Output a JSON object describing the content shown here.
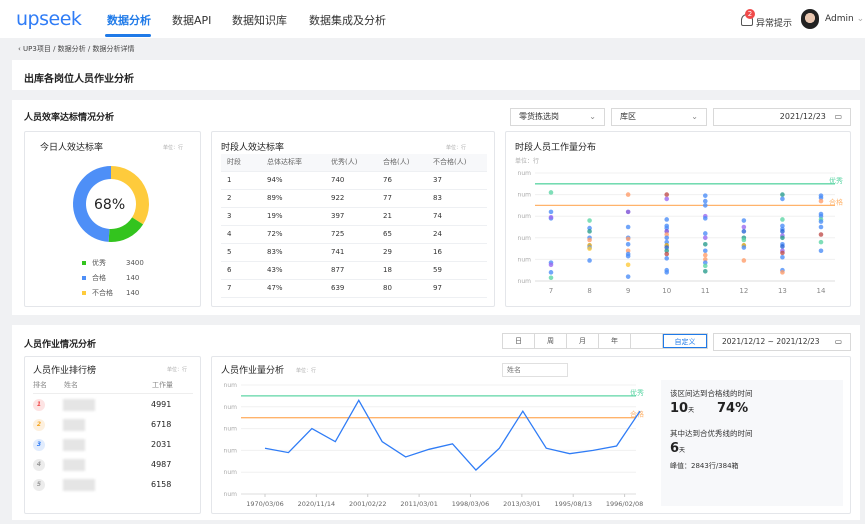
{
  "header": {
    "logo": "upseek",
    "nav": [
      "数据分析",
      "数据API",
      "数据知识库",
      "数据集成及分析"
    ],
    "alert_count": "2",
    "alert_label": "异常提示",
    "user": "Admin"
  },
  "breadcrumb": [
    "UP3项目",
    "数据分析",
    "数据分析详情"
  ],
  "page_title": "出库各岗位人员作业分析",
  "section1": {
    "title": "人员效率达标情况分析",
    "filters": {
      "post": "零货拣选岗",
      "area": "库区",
      "date": "2021/12/23"
    },
    "donut": {
      "title": "今日人效达标率",
      "unit": "单位：行",
      "center": "68%",
      "colors": {
        "优秀": "#33c41e",
        "合格": "#4e8ff7",
        "不合格": "#fecb3c"
      },
      "legend": [
        {
          "label": "优秀",
          "value": "3400",
          "color": "#33c41e"
        },
        {
          "label": "合格",
          "value": "140",
          "color": "#4e8ff7"
        },
        {
          "label": "不合格",
          "value": "140",
          "color": "#fecb3c"
        }
      ],
      "share": {
        "不合格": 0.34,
        "优秀": 0.17,
        "合格": 0.49
      }
    },
    "table": {
      "title": "时段人效达标率",
      "unit": "单位：行",
      "columns": [
        "时段",
        "总体达标率",
        "优秀(人)",
        "合格(人)",
        "不合格(人)"
      ],
      "rows": [
        [
          "1",
          "94%",
          "740",
          "76",
          "37"
        ],
        [
          "2",
          "89%",
          "922",
          "77",
          "83"
        ],
        [
          "3",
          "19%",
          "397",
          "21",
          "74"
        ],
        [
          "4",
          "72%",
          "725",
          "65",
          "24"
        ],
        [
          "5",
          "83%",
          "741",
          "29",
          "16"
        ],
        [
          "6",
          "43%",
          "877",
          "18",
          "59"
        ],
        [
          "7",
          "47%",
          "639",
          "80",
          "97"
        ]
      ]
    },
    "scatter": {
      "title": "时段人员工作量分布",
      "unit": "单位：行",
      "excellent_label": "优秀",
      "pass_label": "合格"
    }
  },
  "section2": {
    "title": "人员作业情况分析",
    "periods": [
      "日",
      "周",
      "月",
      "年",
      "",
      "自定义"
    ],
    "active_period": "自定义",
    "date_range": {
      "start": "2021/12/12",
      "sep": "~",
      "end": "2021/12/23"
    },
    "ranking": {
      "title": "人员作业排行榜",
      "unit": "单位：行",
      "columns": [
        "排名",
        "姓名",
        "工作量"
      ],
      "rows": [
        {
          "rank": "1",
          "value": "4991",
          "color": "#f04a4a",
          "bg": "#fde3e3"
        },
        {
          "rank": "2",
          "value": "6718",
          "color": "#f5a623",
          "bg": "#fdf0de"
        },
        {
          "rank": "3",
          "value": "2031",
          "color": "#2f7cf6",
          "bg": "#e1ecfd"
        },
        {
          "rank": "4",
          "value": "4987",
          "color": "#999",
          "bg": "#ececec"
        },
        {
          "rank": "5",
          "value": "6158",
          "color": "#999",
          "bg": "#ececec"
        }
      ]
    },
    "workload": {
      "title": "人员作业量分析",
      "unit": "单位：行",
      "name_placeholder": "姓名",
      "stats": {
        "pass_title": "该区间达到合格线的时间",
        "pass_days": "10",
        "day_unit": "天",
        "pass_pct": "74%",
        "exc_title": "其中达到合优秀线的时间",
        "exc_days": "6",
        "peak": "峰值：2843行/384箱"
      }
    }
  },
  "chart_data": [
    {
      "type": "scatter",
      "title": "时段人员工作量分布",
      "ylabel": "单位：行",
      "categories": [
        "7",
        "8",
        "9",
        "10",
        "11",
        "12",
        "13",
        "14"
      ],
      "y_tick_labels": [
        "num",
        "num",
        "num",
        "num",
        "num",
        "num"
      ],
      "ylim": [
        0,
        5
      ],
      "grid": true,
      "reference_lines": [
        {
          "name": "优秀",
          "value": 4.5,
          "color": "#5fd6a6"
        },
        {
          "name": "合格",
          "value": 3.5,
          "color": "#ffb36b"
        }
      ],
      "points": [
        [
          7,
          4.1,
          "#5fd6a6"
        ],
        [
          7,
          3.2,
          "#4e8ff7"
        ],
        [
          7,
          2.9,
          "#4e8ff7"
        ],
        [
          7,
          2.95,
          "#9b6cf0"
        ],
        [
          7,
          0.85,
          "#4e8ff7"
        ],
        [
          7,
          0.75,
          "#9b6cf0"
        ],
        [
          7,
          0.4,
          "#4e8ff7"
        ],
        [
          7,
          0.15,
          "#5fd6a6"
        ],
        [
          8,
          2.8,
          "#5fd6a6"
        ],
        [
          8,
          2.45,
          "#4e8ff7"
        ],
        [
          8,
          2.3,
          "#2a9d8f"
        ],
        [
          8,
          2.0,
          "#4e8ff7"
        ],
        [
          8,
          1.9,
          "#ff9d6b"
        ],
        [
          8,
          1.65,
          "#d4a017"
        ],
        [
          8,
          1.55,
          "#4e8ff7"
        ],
        [
          8,
          1.5,
          "#fecb3c"
        ],
        [
          8,
          0.95,
          "#4e8ff7"
        ],
        [
          9,
          4.0,
          "#ff9d6b"
        ],
        [
          9,
          3.2,
          "#7b4fd6"
        ],
        [
          9,
          2.5,
          "#4e8ff7"
        ],
        [
          9,
          2.0,
          "#4e8ff7"
        ],
        [
          9,
          1.95,
          "#ff9d6b"
        ],
        [
          9,
          1.7,
          "#4e8ff7"
        ],
        [
          9,
          1.4,
          "#ff9d6b"
        ],
        [
          9,
          1.25,
          "#4e8ff7"
        ],
        [
          9,
          1.15,
          "#4e8ff7"
        ],
        [
          9,
          0.75,
          "#fecb3c"
        ],
        [
          9,
          0.2,
          "#4e8ff7"
        ],
        [
          10,
          4.0,
          "#c0504d"
        ],
        [
          10,
          3.8,
          "#9b6cf0"
        ],
        [
          10,
          2.85,
          "#4e8ff7"
        ],
        [
          10,
          2.55,
          "#4e8ff7"
        ],
        [
          10,
          2.45,
          "#4e8ff7"
        ],
        [
          10,
          2.3,
          "#7b4fd6"
        ],
        [
          10,
          2.15,
          "#ff9d6b"
        ],
        [
          10,
          2.0,
          "#4e8ff7"
        ],
        [
          10,
          1.8,
          "#4e8ff7"
        ],
        [
          10,
          1.65,
          "#d4a017"
        ],
        [
          10,
          1.55,
          "#2a66d6"
        ],
        [
          10,
          1.4,
          "#2a9d8f"
        ],
        [
          10,
          1.25,
          "#c0504d"
        ],
        [
          10,
          1.05,
          "#4e8ff7"
        ],
        [
          10,
          0.5,
          "#4e8ff7"
        ],
        [
          10,
          0.4,
          "#4e8ff7"
        ],
        [
          11,
          3.95,
          "#4e8ff7"
        ],
        [
          11,
          3.7,
          "#4e8ff7"
        ],
        [
          11,
          3.5,
          "#4e8ff7"
        ],
        [
          11,
          3.0,
          "#9b6cf0"
        ],
        [
          11,
          2.9,
          "#4e8ff7"
        ],
        [
          11,
          2.2,
          "#4e8ff7"
        ],
        [
          11,
          2.0,
          "#9b6cf0"
        ],
        [
          11,
          1.7,
          "#2a9d8f"
        ],
        [
          11,
          1.4,
          "#4e8ff7"
        ],
        [
          11,
          1.2,
          "#ff9d6b"
        ],
        [
          11,
          1.0,
          "#ff9d6b"
        ],
        [
          11,
          0.85,
          "#4e8ff7"
        ],
        [
          11,
          0.7,
          "#5fd6a6"
        ],
        [
          11,
          0.45,
          "#2a9d8f"
        ],
        [
          12,
          2.8,
          "#4e8ff7"
        ],
        [
          12,
          2.5,
          "#9b6cf0"
        ],
        [
          12,
          2.3,
          "#2a66d6"
        ],
        [
          12,
          2.0,
          "#2a9d8f"
        ],
        [
          12,
          1.9,
          "#5fd6a6"
        ],
        [
          12,
          1.65,
          "#d4a017"
        ],
        [
          12,
          1.55,
          "#4e8ff7"
        ],
        [
          12,
          0.95,
          "#ff9d6b"
        ],
        [
          13,
          4.0,
          "#2a9d8f"
        ],
        [
          13,
          3.8,
          "#4e8ff7"
        ],
        [
          13,
          2.85,
          "#5fd6a6"
        ],
        [
          13,
          2.55,
          "#4e8ff7"
        ],
        [
          13,
          2.4,
          "#4e8ff7"
        ],
        [
          13,
          2.3,
          "#2a66d6"
        ],
        [
          13,
          2.1,
          "#9b6cf0"
        ],
        [
          13,
          2.0,
          "#2a9d8f"
        ],
        [
          13,
          1.7,
          "#4e8ff7"
        ],
        [
          13,
          1.6,
          "#2a66d6"
        ],
        [
          13,
          1.4,
          "#9b6cf0"
        ],
        [
          13,
          1.3,
          "#c0504d"
        ],
        [
          13,
          1.1,
          "#4e8ff7"
        ],
        [
          13,
          0.5,
          "#4e8ff7"
        ],
        [
          13,
          0.4,
          "#ff9d6b"
        ],
        [
          14,
          3.95,
          "#4e8ff7"
        ],
        [
          14,
          3.85,
          "#4e8ff7"
        ],
        [
          14,
          3.7,
          "#ff9d6b"
        ],
        [
          14,
          3.1,
          "#4e8ff7"
        ],
        [
          14,
          3.0,
          "#4e8ff7"
        ],
        [
          14,
          2.85,
          "#5fd6a6"
        ],
        [
          14,
          2.75,
          "#4e8ff7"
        ],
        [
          14,
          2.5,
          "#4e8ff7"
        ],
        [
          14,
          2.15,
          "#c0504d"
        ],
        [
          14,
          1.8,
          "#5fd6a6"
        ],
        [
          14,
          1.4,
          "#4e8ff7"
        ]
      ]
    },
    {
      "type": "line",
      "title": "人员作业量分析",
      "ylabel": "单位：行",
      "y_tick_labels": [
        "num",
        "num",
        "num",
        "num",
        "num",
        "num"
      ],
      "ylim": [
        0,
        5
      ],
      "grid": true,
      "x_tick_labels": [
        "1970/03/06",
        "2020/11/14",
        "2001/02/22",
        "2011/03/01",
        "1998/03/06",
        "2013/03/01",
        "1995/08/13",
        "1996/02/08"
      ],
      "reference_lines": [
        {
          "name": "优秀",
          "value": 4.5,
          "color": "#5fd6a6"
        },
        {
          "name": "合格",
          "value": 3.5,
          "color": "#ffb36b"
        }
      ],
      "series": [
        {
          "color": "#2f7cf6",
          "values": [
            2.1,
            1.9,
            3.0,
            2.4,
            4.3,
            2.4,
            1.7,
            2.05,
            2.3,
            1.1,
            2.1,
            3.8,
            2.1,
            1.85,
            2.0,
            2.2,
            3.8
          ]
        }
      ]
    }
  ]
}
